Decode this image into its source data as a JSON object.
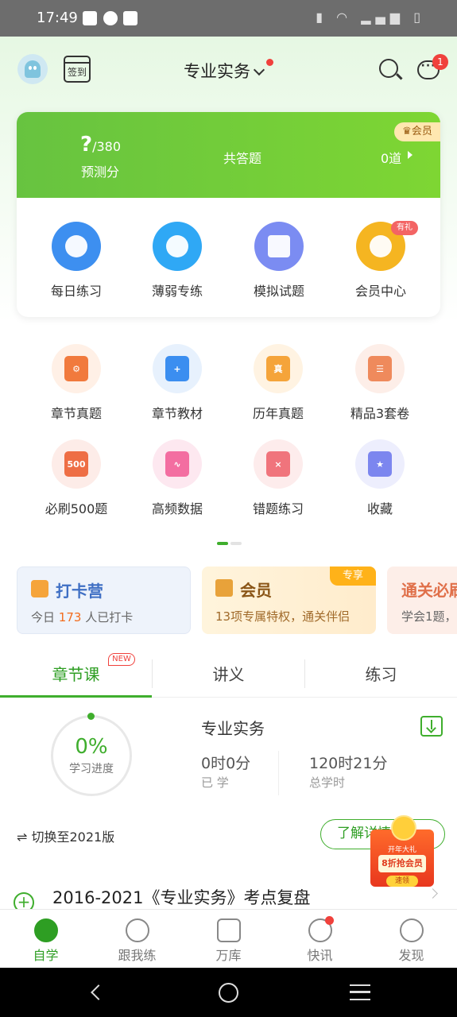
{
  "status_bar": {
    "time": "17:49"
  },
  "header": {
    "subject_title": "专业实务",
    "message_badge": "1",
    "signin_label": "签到"
  },
  "prediction_card": {
    "score_value": "?",
    "score_total": "/380",
    "score_label": "预测分",
    "total_label": "共答题",
    "answer_count": "0道",
    "vip_tag": "♛会员",
    "quick_actions": [
      {
        "label": "每日练习",
        "color": "#3d8ff0"
      },
      {
        "label": "薄弱专练",
        "color": "#2fa8f5"
      },
      {
        "label": "模拟试题",
        "color": "#7b8cf2"
      },
      {
        "label": "会员中心",
        "color": "#f5b521",
        "badge": "有礼"
      }
    ]
  },
  "grid": [
    {
      "label": "章节真题",
      "bg": "#fff0e6",
      "fg": "#f17a3d",
      "glyph": "⚙"
    },
    {
      "label": "章节教材",
      "bg": "#e7f1fd",
      "fg": "#3b8ef0",
      "glyph": "+"
    },
    {
      "label": "历年真题",
      "bg": "#fff3e2",
      "fg": "#f5a43a",
      "glyph": "真"
    },
    {
      "label": "精品3套卷",
      "bg": "#fdeee8",
      "fg": "#ef8a5c",
      "glyph": "☰"
    },
    {
      "label": "必刷500题",
      "bg": "#fdece8",
      "fg": "#ee6e45",
      "glyph": "500"
    },
    {
      "label": "高频数据",
      "bg": "#fde8f0",
      "fg": "#f36ea1",
      "glyph": "∿"
    },
    {
      "label": "错题练习",
      "bg": "#fdecec",
      "fg": "#f0747c",
      "glyph": "×"
    },
    {
      "label": "收藏",
      "bg": "#edeefd",
      "fg": "#7c86ef",
      "glyph": "★"
    }
  ],
  "promos": {
    "checkin": {
      "title": "打卡营",
      "sub_prefix": "今日",
      "count": "173",
      "sub_suffix": "人已打卡"
    },
    "member": {
      "title": "会员",
      "sub": "13项专属特权，通关伴侣",
      "tag": "专享"
    },
    "pass": {
      "title": "通关必刷",
      "sub": "学会1题，"
    }
  },
  "tabs": [
    {
      "label": "章节课",
      "badge": "NEW"
    },
    {
      "label": "讲义"
    },
    {
      "label": "练习"
    }
  ],
  "course": {
    "progress": "0%",
    "progress_label": "学习进度",
    "name": "专业实务",
    "learned_value": "0时0分",
    "learned_label": "已 学",
    "total_value": "120时21分",
    "total_label": "总学时",
    "switch_label": "⇌ 切换至2021版",
    "learn_more": "了解详情"
  },
  "float_ad": {
    "line1": "开年大礼",
    "line2": "8折抢会员",
    "line3": "速领"
  },
  "list_item": {
    "title": "2016-2021《专业实务》考点复盘"
  },
  "bottom_nav": [
    {
      "label": "自学",
      "active": true
    },
    {
      "label": "跟我练"
    },
    {
      "label": "万库"
    },
    {
      "label": "快讯",
      "dot": true
    },
    {
      "label": "发现"
    }
  ]
}
